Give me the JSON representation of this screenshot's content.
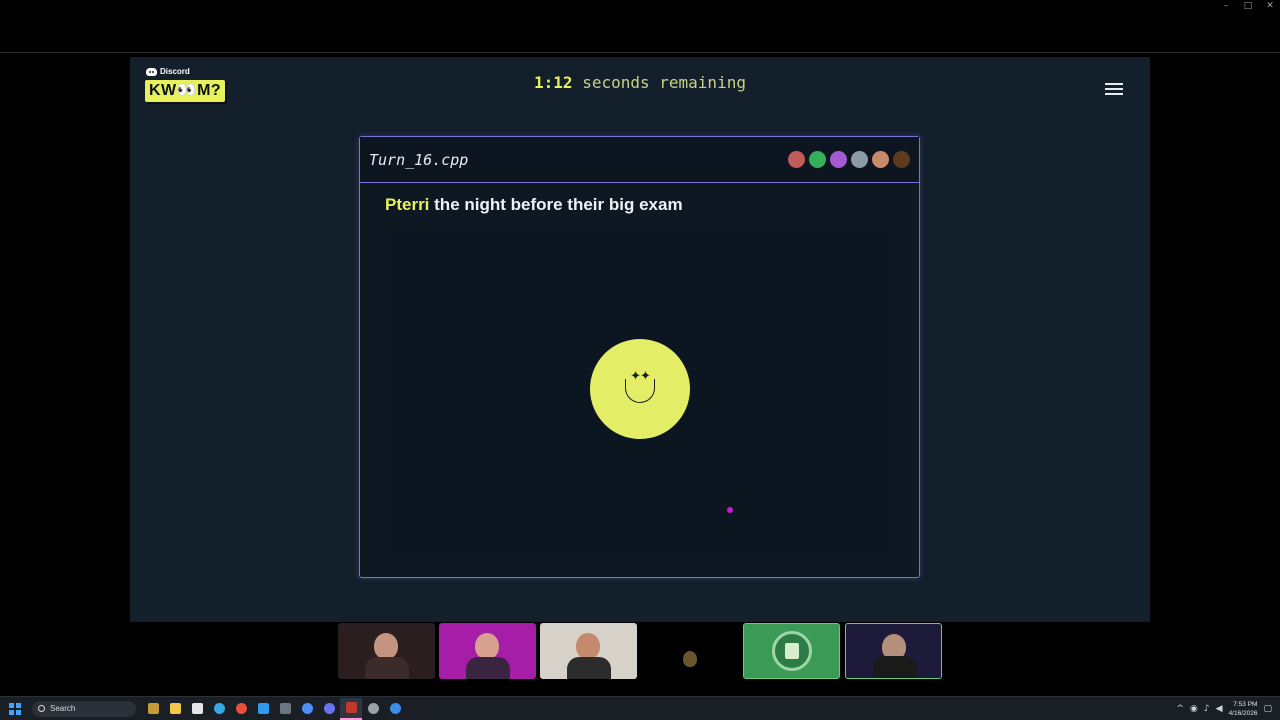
{
  "window": {
    "controls": [
      "–",
      "□",
      "✕"
    ]
  },
  "activity": {
    "brand_small": "Discord",
    "logo_text": "KW👀M?",
    "timer_value": "1:12",
    "timer_rest": "seconds remaining"
  },
  "card": {
    "file_name": "Turn_16.cpp",
    "avatar_colors": [
      "#c05c5c",
      "#34b05a",
      "#a55bd0",
      "#8c9aa6",
      "#c98a6b",
      "#5e3b1b"
    ],
    "prompt_name": "Pterri",
    "prompt_text": " the night before their big exam",
    "smiley_eyes": "✦✦"
  },
  "videos": {
    "tiles": [
      {
        "bg": "#2a1e20",
        "skin": "#c49480",
        "shirt": "#3b2b2b"
      },
      {
        "bg": "#a61ea8",
        "skin": "#d8a08e",
        "shirt": "#3a2540"
      },
      {
        "bg": "#d7d2c9",
        "skin": "#c58a6d",
        "shirt": "#2c2c2c"
      },
      {
        "bg": "transparent",
        "skin": "#6a5530",
        "shirt": "transparent"
      },
      {
        "bg": "#3a9a56",
        "skin": "",
        "shirt": ""
      },
      {
        "bg": "#1d1a3a",
        "skin": "#b58f7b",
        "shirt": "#1a1a1a"
      }
    ]
  },
  "taskbar": {
    "search_placeholder": "Search",
    "time": "7:53 PM",
    "date": "4/16/2026",
    "app_icons": [
      {
        "name": "widgets-icon",
        "color": "#c79a3a"
      },
      {
        "name": "file-explorer-icon",
        "color": "#f1c84a"
      },
      {
        "name": "store-icon",
        "color": "#e6e6e6"
      },
      {
        "name": "edge-icon",
        "color": "#37a7e6"
      },
      {
        "name": "chrome-icon",
        "color": "#e6503c"
      },
      {
        "name": "vscode-icon",
        "color": "#2f9bea"
      },
      {
        "name": "calculator-icon",
        "color": "#6d7580"
      },
      {
        "name": "copilot-icon",
        "color": "#4f8ff7"
      },
      {
        "name": "discord-icon",
        "color": "#6b73f0"
      },
      {
        "name": "app-icon",
        "color": "#c0392b"
      },
      {
        "name": "settings-icon",
        "color": "#9aa0a6"
      },
      {
        "name": "app-blue-icon",
        "color": "#3d8de8"
      }
    ]
  }
}
